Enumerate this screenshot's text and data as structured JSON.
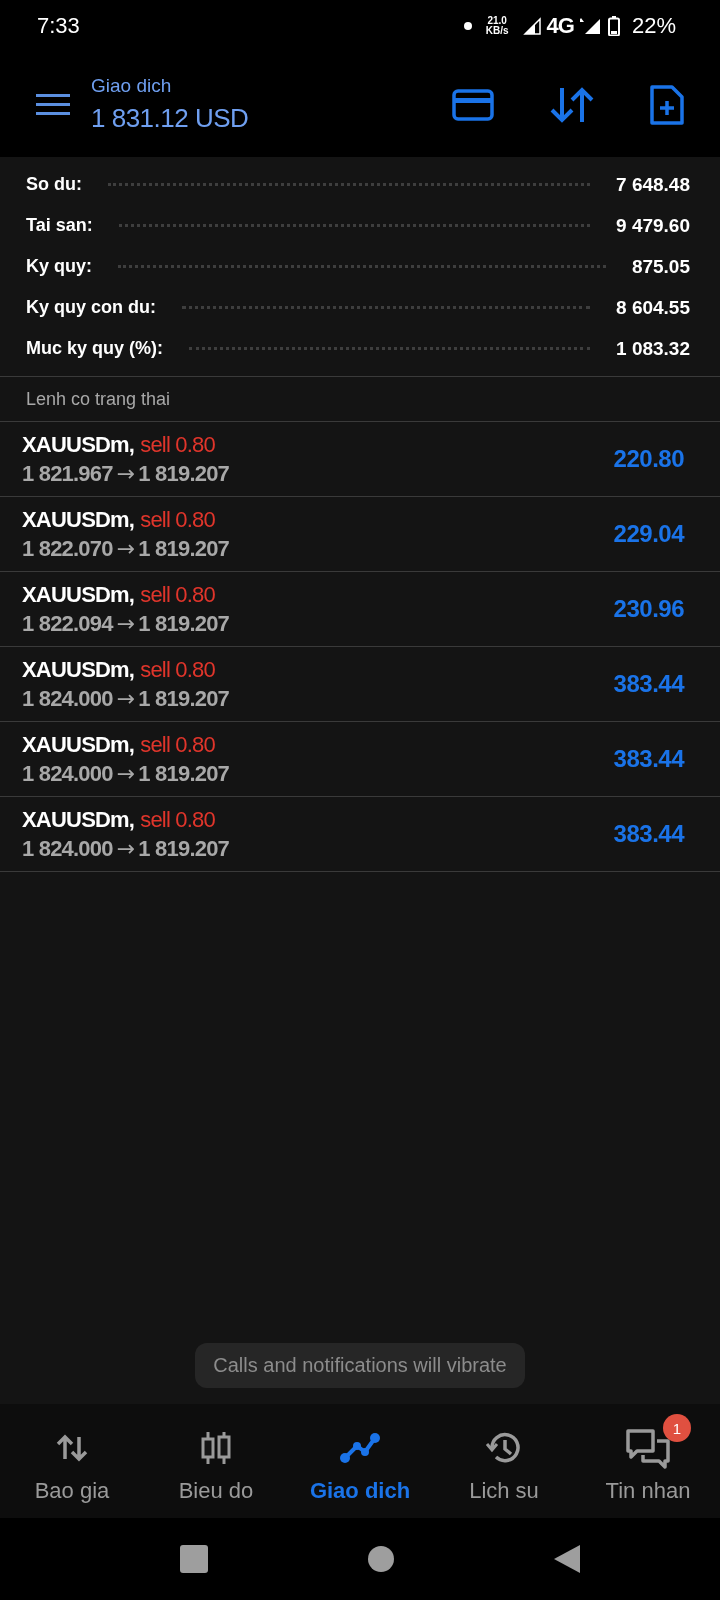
{
  "status_bar": {
    "time": "7:33",
    "speed_value": "21.0",
    "speed_unit": "KB/s",
    "network": "4G",
    "battery": "22%"
  },
  "header": {
    "title": "Giao dich",
    "balance": "1 831.12 USD"
  },
  "summary": [
    {
      "label": "So du:",
      "value": "7 648.48"
    },
    {
      "label": "Tai san:",
      "value": "9 479.60"
    },
    {
      "label": "Ky quy:",
      "value": "875.05"
    },
    {
      "label": "Ky quy con du:",
      "value": "8 604.55"
    },
    {
      "label": "Muc ky quy (%):",
      "value": "1 083.32"
    }
  ],
  "section_title": "Lenh co trang thai",
  "orders": [
    {
      "symbol": "XAUUSDm,",
      "kind": "sell",
      "trade": "sell 0.80",
      "open_price": "1 821.967",
      "arrow": "→",
      "current_price": "1 819.207",
      "profit": "220.80"
    },
    {
      "symbol": "XAUUSDm,",
      "kind": "sell",
      "trade": "sell 0.80",
      "open_price": "1 822.070",
      "arrow": "→",
      "current_price": "1 819.207",
      "profit": "229.04"
    },
    {
      "symbol": "XAUUSDm,",
      "kind": "sell",
      "trade": "sell 0.80",
      "open_price": "1 822.094",
      "arrow": "→",
      "current_price": "1 819.207",
      "profit": "230.96"
    },
    {
      "symbol": "XAUUSDm,",
      "kind": "sell",
      "trade": "sell 0.80",
      "open_price": "1 824.000",
      "arrow": "→",
      "current_price": "1 819.207",
      "profit": "383.44"
    },
    {
      "symbol": "XAUUSDm,",
      "kind": "sell",
      "trade": "sell 0.80",
      "open_price": "1 824.000",
      "arrow": "→",
      "current_price": "1 819.207",
      "profit": "383.44"
    },
    {
      "symbol": "XAUUSDm,",
      "kind": "sell",
      "trade": "sell 0.80",
      "open_price": "1 824.000",
      "arrow": "→",
      "current_price": "1 819.207",
      "profit": "383.44"
    }
  ],
  "toast": "Calls and notifications will vibrate",
  "nav": [
    {
      "label": "Bao gia",
      "kind": "quotes",
      "selected": false
    },
    {
      "label": "Bieu do",
      "kind": "chart",
      "selected": false
    },
    {
      "label": "Giao dich",
      "kind": "trade",
      "selected": true
    },
    {
      "label": "Lich su",
      "kind": "history",
      "selected": false
    },
    {
      "label": "Tin nhan",
      "kind": "messages",
      "selected": false,
      "badge": "1"
    }
  ]
}
